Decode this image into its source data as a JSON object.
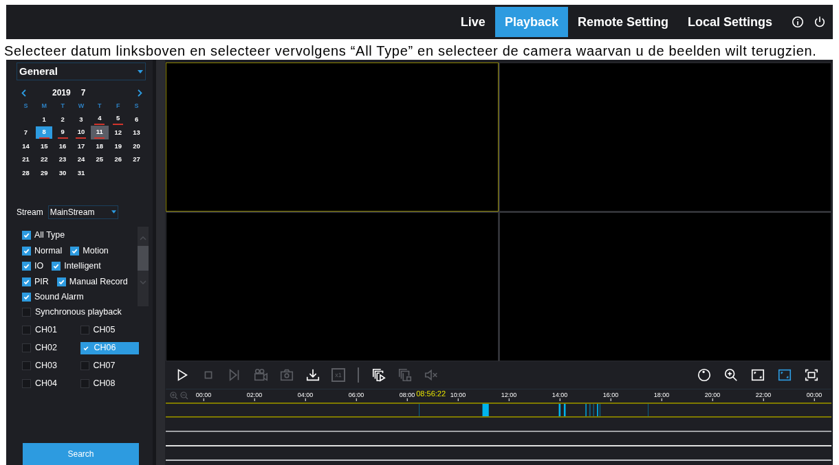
{
  "top_bar": {
    "menu": [
      {
        "label": "Live",
        "selected": false
      },
      {
        "label": "Playback",
        "selected": true
      },
      {
        "label": "Remote Setting",
        "selected": false
      },
      {
        "label": "Local Settings",
        "selected": false
      }
    ]
  },
  "instruction": "Selecteer datum linksboven en selecteer vervolgens “All Type” en selecteer de camera waarvan u de beelden wilt terugzien.",
  "sidebar": {
    "mode_select": {
      "value": "General"
    },
    "calendar": {
      "year": "2019",
      "month": "7",
      "weekdays": [
        "S",
        "M",
        "T",
        "W",
        "T",
        "F",
        "S"
      ],
      "weeks": [
        [
          {
            "label": "1",
            "recorded": false,
            "selected": false,
            "current": false
          },
          {
            "label": "2",
            "recorded": false,
            "selected": false,
            "current": false
          },
          {
            "label": "3",
            "recorded": false,
            "selected": false,
            "current": false
          },
          {
            "label": "4",
            "recorded": true,
            "selected": false,
            "current": false
          },
          {
            "label": "5",
            "recorded": true,
            "selected": false,
            "current": false
          },
          {
            "label": "6",
            "recorded": false,
            "selected": false,
            "current": false
          }
        ],
        [
          {
            "label": "7",
            "recorded": false,
            "selected": false,
            "current": false
          },
          {
            "label": "8",
            "recorded": true,
            "selected": true,
            "current": false
          },
          {
            "label": "9",
            "recorded": true,
            "selected": false,
            "current": false
          },
          {
            "label": "10",
            "recorded": true,
            "selected": false,
            "current": false
          },
          {
            "label": "11",
            "recorded": true,
            "selected": false,
            "current": true
          },
          {
            "label": "12",
            "recorded": false,
            "selected": false,
            "current": false
          },
          {
            "label": "13",
            "recorded": false,
            "selected": false,
            "current": false
          }
        ],
        [
          {
            "label": "14",
            "recorded": false,
            "selected": false,
            "current": false
          },
          {
            "label": "15",
            "recorded": false,
            "selected": false,
            "current": false
          },
          {
            "label": "16",
            "recorded": false,
            "selected": false,
            "current": false
          },
          {
            "label": "17",
            "recorded": false,
            "selected": false,
            "current": false
          },
          {
            "label": "18",
            "recorded": false,
            "selected": false,
            "current": false
          },
          {
            "label": "19",
            "recorded": false,
            "selected": false,
            "current": false
          },
          {
            "label": "20",
            "recorded": false,
            "selected": false,
            "current": false
          }
        ],
        [
          {
            "label": "21",
            "recorded": false,
            "selected": false,
            "current": false
          },
          {
            "label": "22",
            "recorded": false,
            "selected": false,
            "current": false
          },
          {
            "label": "23",
            "recorded": false,
            "selected": false,
            "current": false
          },
          {
            "label": "24",
            "recorded": false,
            "selected": false,
            "current": false
          },
          {
            "label": "25",
            "recorded": false,
            "selected": false,
            "current": false
          },
          {
            "label": "26",
            "recorded": false,
            "selected": false,
            "current": false
          },
          {
            "label": "27",
            "recorded": false,
            "selected": false,
            "current": false
          }
        ],
        [
          {
            "label": "28",
            "recorded": false,
            "selected": false,
            "current": false
          },
          {
            "label": "29",
            "recorded": false,
            "selected": false,
            "current": false
          },
          {
            "label": "30",
            "recorded": false,
            "selected": false,
            "current": false
          },
          {
            "label": "31",
            "recorded": false,
            "selected": false,
            "current": false
          }
        ]
      ]
    },
    "stream": {
      "label": "Stream",
      "value": "MainStream"
    },
    "record_types": [
      [
        {
          "label": "All Type",
          "checked": true
        }
      ],
      [
        {
          "label": "Normal",
          "checked": true
        },
        {
          "label": "Motion",
          "checked": true
        }
      ],
      [
        {
          "label": "IO",
          "checked": true
        },
        {
          "label": "Intelligent",
          "checked": true
        }
      ],
      [
        {
          "label": "PIR",
          "checked": true
        },
        {
          "label": "Manual Record",
          "checked": true
        }
      ],
      [
        {
          "label": "Sound Alarm",
          "checked": true
        }
      ]
    ],
    "sync": {
      "label": "Synchronous playback",
      "checked": false
    },
    "channels": [
      {
        "label": "CH01",
        "checked": false
      },
      {
        "label": "CH02",
        "checked": false
      },
      {
        "label": "CH03",
        "checked": false
      },
      {
        "label": "CH04",
        "checked": false
      },
      {
        "label": "CH05",
        "checked": false
      },
      {
        "label": "CH06",
        "checked": true
      },
      {
        "label": "CH07",
        "checked": false
      },
      {
        "label": "CH08",
        "checked": false
      }
    ],
    "search_button": "Search"
  },
  "main": {
    "video_cells": [
      {
        "selected": true
      },
      {
        "selected": false
      },
      {
        "selected": false
      },
      {
        "selected": false
      }
    ],
    "toolbar_left": [
      {
        "kind": "play",
        "disabled": false
      },
      {
        "kind": "stop",
        "disabled": true
      },
      {
        "kind": "step",
        "disabled": true
      },
      {
        "kind": "clip",
        "disabled": true
      },
      {
        "kind": "snapshot",
        "disabled": true
      },
      {
        "kind": "download",
        "disabled": false
      },
      {
        "kind": "speed",
        "label": "x1",
        "disabled": true
      },
      {
        "kind": "divider"
      },
      {
        "kind": "sync_play",
        "disabled": false
      },
      {
        "kind": "sync_stop",
        "disabled": true
      },
      {
        "kind": "mute",
        "disabled": true
      }
    ],
    "toolbar_right": [
      {
        "kind": "clock",
        "selected": false
      },
      {
        "kind": "zoom",
        "selected": false
      },
      {
        "kind": "frame",
        "selected": false
      },
      {
        "kind": "frame",
        "selected": true
      },
      {
        "kind": "fullscreen",
        "selected": false
      }
    ],
    "timeline": {
      "ticks": [
        "00:00",
        "02:00",
        "04:00",
        "06:00",
        "08:00",
        "10:00",
        "12:00",
        "14:00",
        "16:00",
        "18:00",
        "20:00",
        "22:00",
        "00:00"
      ],
      "cursor_time": "08:56:22"
    }
  }
}
